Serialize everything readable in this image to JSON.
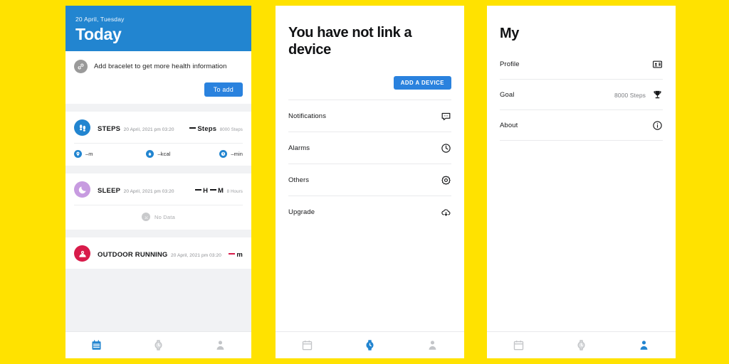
{
  "theme": {
    "background": "#FFE200",
    "accent_blue": "#2285D0",
    "button_blue": "#2A82DE",
    "sleep_purple": "#C79BE0",
    "running_red": "#D81B4A",
    "muted_gray": "#9A9CA0"
  },
  "today": {
    "header": {
      "date": "20 April, Tuesday",
      "title": "Today"
    },
    "bracelet": {
      "icon": "bracelet-icon",
      "message": "Add bracelet to get more health information",
      "button_label": "To add"
    },
    "cards": [
      {
        "id": "steps",
        "icon": "footsteps-icon",
        "name": "STEPS",
        "timestamp": "20 April, 2021 pm 03:20",
        "value_label": "Steps",
        "value_dash": "—",
        "sub_value": "8000 Steps",
        "stats": [
          {
            "icon": "location-pin-icon",
            "label": "–m"
          },
          {
            "icon": "flame-icon",
            "label": "–kcal"
          },
          {
            "icon": "clock-icon",
            "label": "–min"
          }
        ]
      },
      {
        "id": "sleep",
        "icon": "moon-icon",
        "name": "SLEEP",
        "timestamp": "20 April, 2021 pm 03:20",
        "value_hours_label": "H",
        "value_minutes_label": "M",
        "sub_value": "8 Hours",
        "empty_icon": "sad-face-icon",
        "empty_text": "No Data"
      },
      {
        "id": "outdoor-running",
        "icon": "running-location-icon",
        "name": "OUTDOOR RUNNING",
        "timestamp": "20 April, 2021 pm 03:20",
        "value_label": "m"
      }
    ],
    "tabs": [
      {
        "name": "calendar",
        "icon": "calendar-icon",
        "active": true
      },
      {
        "name": "device",
        "icon": "watch-icon",
        "active": false
      },
      {
        "name": "profile",
        "icon": "person-icon",
        "active": false
      }
    ]
  },
  "device": {
    "title": "You have not link a device",
    "add_button_label": "ADD A DEVICE",
    "menu": [
      {
        "label": "Notifications",
        "icon": "chat-bubble-icon"
      },
      {
        "label": "Alarms",
        "icon": "clock-icon"
      },
      {
        "label": "Others",
        "icon": "gear-icon"
      },
      {
        "label": "Upgrade",
        "icon": "cloud-download-icon"
      }
    ],
    "tabs": [
      {
        "name": "calendar",
        "icon": "calendar-icon",
        "active": false
      },
      {
        "name": "device",
        "icon": "watch-icon",
        "active": true
      },
      {
        "name": "profile",
        "icon": "person-icon",
        "active": false
      }
    ]
  },
  "my": {
    "title": "My",
    "items": [
      {
        "label": "Profile",
        "value": "",
        "icon": "id-card-icon"
      },
      {
        "label": "Goal",
        "value": "8000 Steps",
        "icon": "trophy-icon"
      },
      {
        "label": "About",
        "value": "",
        "icon": "info-circle-icon"
      }
    ],
    "tabs": [
      {
        "name": "calendar",
        "icon": "calendar-icon",
        "active": false
      },
      {
        "name": "device",
        "icon": "watch-icon",
        "active": false
      },
      {
        "name": "profile",
        "icon": "person-icon",
        "active": true
      }
    ]
  }
}
